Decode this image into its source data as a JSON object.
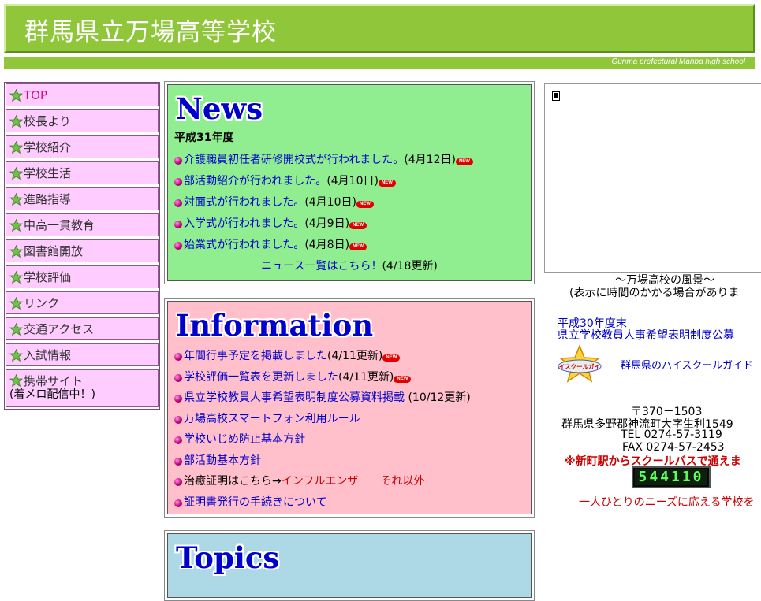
{
  "header": {
    "title": "群馬県立万場高等学校",
    "subtitle": "Gunma prefectural Manba high school"
  },
  "sidebar": {
    "items": [
      {
        "label": "TOP"
      },
      {
        "label": "校長より"
      },
      {
        "label": "学校紹介"
      },
      {
        "label": "学校生活"
      },
      {
        "label": "進路指導"
      },
      {
        "label": "中高一貫教育"
      },
      {
        "label": "図書館開放"
      },
      {
        "label": "学校評価"
      },
      {
        "label": "リンク"
      },
      {
        "label": "交通アクセス"
      },
      {
        "label": "入試情報"
      },
      {
        "label": "携帯サイト",
        "sub": "(着メロ配信中！)"
      }
    ]
  },
  "news": {
    "heading": "News",
    "year": "平成31年度",
    "items": [
      {
        "text": "介護職員初任者研修開校式が行われました。",
        "date": "(4月12日)"
      },
      {
        "text": "部活動紹介が行われました。",
        "date": "(4月10日)"
      },
      {
        "text": "対面式が行われました。",
        "date": "(4月10日)"
      },
      {
        "text": "入学式が行われました。",
        "date": "(4月9日)"
      },
      {
        "text": "始業式が行われました。",
        "date": "(4月8日)"
      }
    ],
    "more_link": "ニュース一覧はこちら！",
    "more_date": "(4/18更新)",
    "new_badge": "NEW"
  },
  "information": {
    "heading": "Information",
    "items": [
      {
        "text": "年間行事予定を掲載しました",
        "note": "(4/11更新)"
      },
      {
        "text": "学校評価一覧表を更新しました",
        "note": "(4/11更新)"
      },
      {
        "text": "県立学校教員人事希望表明制度公募資料掲載",
        "note": " (10/12更新)"
      },
      {
        "text": "万場高校スマートフォン利用ルール"
      },
      {
        "text": "学校いじめ防止基本方針"
      },
      {
        "text": "部活動基本方針"
      },
      {
        "prefix": "治癒証明はこちら→",
        "link1": "インフルエンザ",
        "link2": "それ以外"
      },
      {
        "text": "証明書発行の手続きについて"
      }
    ]
  },
  "topics": {
    "heading": "Topics"
  },
  "right": {
    "scenery_caption": "～万場高校の風景～",
    "scenery_note": "(表示に時間のかかる場合がありま",
    "recruit_link_line1": "平成30年度末",
    "recruit_link_line2": "県立学校教員人事希望表明制度公募",
    "hs_logo_text": "ハイスクールガイド",
    "hs_guide_link": "群馬県のハイスクールガイド",
    "postal": "〒370－1503",
    "address": "群馬県多野郡神流町大字生利1549",
    "tel": "TEL 0274-57-3119",
    "fax": "FAX 0274-57-2453",
    "bus_note": "※新町駅からスクールバスで通えま",
    "counter": "544110",
    "motto": "一人ひとりのニーズに応える学校を"
  },
  "colors": {
    "header_green": "#8fc63a",
    "nav_pink": "#ffccff",
    "news_bg": "#90ee90",
    "info_bg": "#ffc0cb",
    "topics_bg": "#add8e6",
    "link_blue": "#0000cc",
    "alert_red": "#cc0000"
  }
}
